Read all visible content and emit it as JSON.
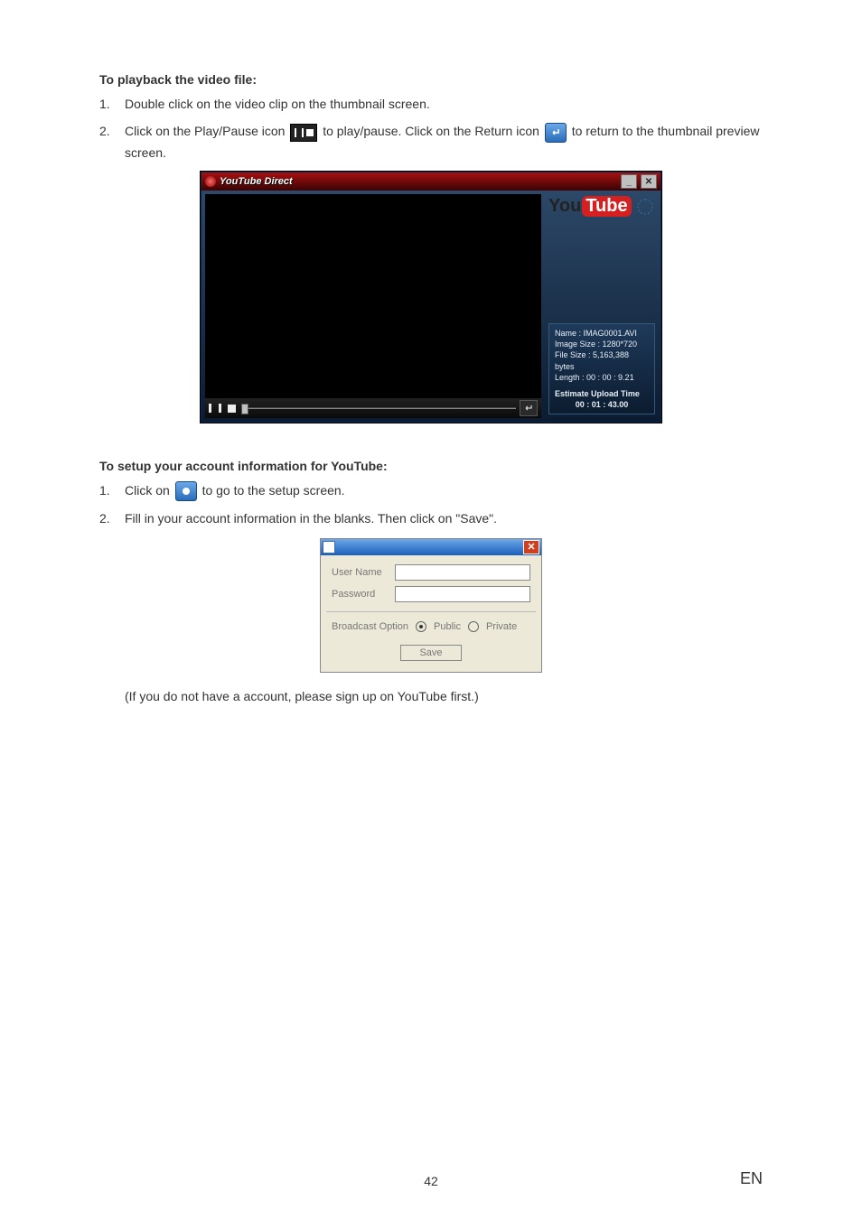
{
  "section1": {
    "heading": "To playback the video file:",
    "items": [
      {
        "num": "1.",
        "text": "Double click on the video clip on the thumbnail screen."
      },
      {
        "num": "2.",
        "pre": "Click on the Play/Pause icon ",
        "mid": " to play/pause. Click on the Return icon ",
        "post": " to return to the thumbnail preview screen."
      }
    ]
  },
  "app": {
    "title": "YouTube Direct",
    "logo_you": "You",
    "logo_tube": "Tube",
    "info": {
      "name": "Name : IMAG0001.AVI",
      "size": "Image Size : 1280*720",
      "filesize": "File Size : 5,163,388 bytes",
      "length": "Length : 00 : 00 : 9.21",
      "est_label": "Estimate Upload Time",
      "est_time": "00 : 01 : 43.00"
    }
  },
  "section2": {
    "heading": "To setup your account information for YouTube:",
    "items": [
      {
        "num": "1.",
        "pre": "Click on ",
        "post": " to go to the setup screen."
      },
      {
        "num": "2.",
        "text": "Fill in your account information in the blanks. Then click on \"Save\"."
      }
    ],
    "note": "(If you do not have a account, please sign up on YouTube first.)"
  },
  "dialog": {
    "user_label": "User Name",
    "pass_label": "Password",
    "broadcast_label": "Broadcast Option",
    "public": "Public",
    "private": "Private",
    "save": "Save"
  },
  "footer": {
    "page": "42",
    "lang": "EN"
  }
}
